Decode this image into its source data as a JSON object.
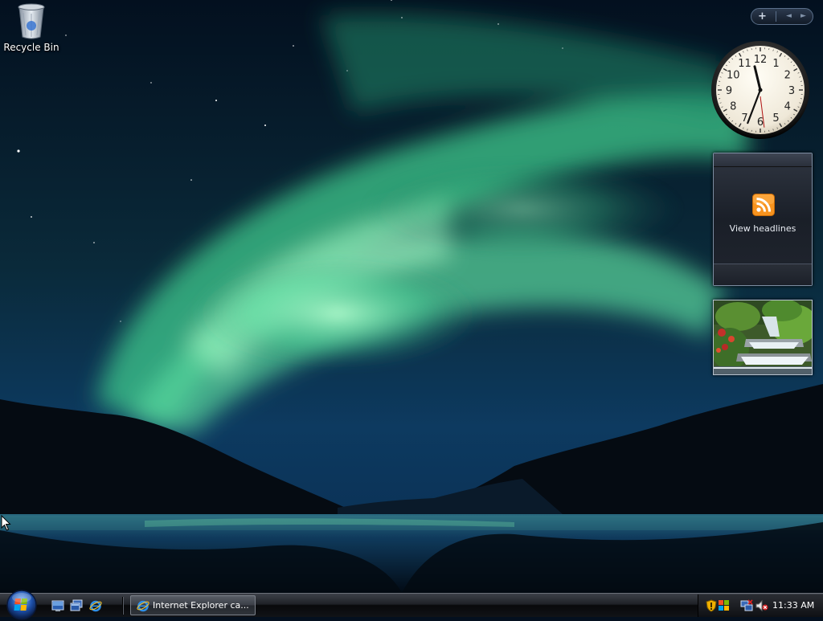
{
  "desktop": {
    "icons": [
      {
        "label": "Recycle Bin",
        "icon": "recycle-bin-icon"
      }
    ]
  },
  "sidebar": {
    "controls": {
      "add": "+",
      "prev": "◄",
      "next": "►"
    },
    "clock": {
      "hour": 11,
      "minute": 33,
      "second": 29,
      "numerals": [
        "12",
        "1",
        "2",
        "3",
        "4",
        "5",
        "6",
        "7",
        "8",
        "9",
        "10",
        "11"
      ]
    },
    "feeds": {
      "label": "View headlines",
      "icon": "rss-icon",
      "accent": "#f7931e"
    },
    "slideshow": {
      "icon": "slideshow-photo-waterfall"
    }
  },
  "taskbar": {
    "start": {
      "icon": "windows-orb-icon"
    },
    "quick_launch": [
      {
        "name": "show-desktop",
        "icon": "show-desktop-icon"
      },
      {
        "name": "switch-windows",
        "icon": "switch-windows-icon"
      },
      {
        "name": "internet-explorer",
        "icon": "ie-icon"
      }
    ],
    "tasks": [
      {
        "label": "Internet Explorer ca...",
        "icon": "ie-icon"
      }
    ],
    "tray": {
      "icons": [
        "security-shield-icon",
        "windows-security-icon",
        "network-icon",
        "volume-muted-icon"
      ],
      "time": "11:33 AM"
    }
  }
}
